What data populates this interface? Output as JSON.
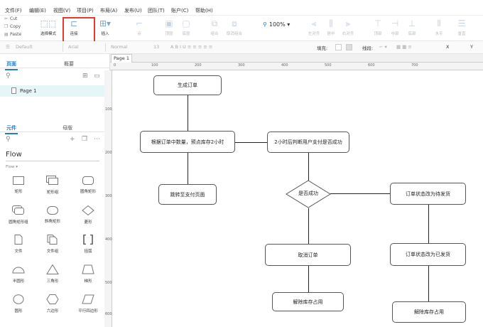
{
  "menubar": {
    "items": [
      "文件(F)",
      "编辑(E)",
      "视图(V)",
      "项目(P)",
      "布局(A)",
      "发布(U)",
      "团队(T)",
      "账户(C)",
      "帮助(H)"
    ]
  },
  "clipboard": {
    "cut": "Cut",
    "copy": "Copy",
    "paste": "Paste"
  },
  "toolbar": {
    "select_mode": "选择模式",
    "connect": "连接",
    "insert": "插入",
    "point": "点",
    "top_layer": "顶层",
    "bottom_layer": "底层",
    "combine": "组合",
    "uncombine": "取消组合",
    "zoom": "100%",
    "align_left": "左对齐",
    "align_center": "居中",
    "align_right": "右对齐",
    "align_top": "顶部",
    "align_middle": "中部",
    "align_bottom": "底部",
    "distribute_h": "水平",
    "distribute_v": "垂直"
  },
  "formatbar": {
    "style": "Default",
    "font": "Arial",
    "weight": "Normal",
    "size": "13",
    "fill_label": "填充:",
    "line_label": "线段:",
    "x_label": "X",
    "y_label": "Y"
  },
  "pages_panel": {
    "tabs": [
      "页面",
      "概要"
    ],
    "pages": [
      "Page 1"
    ]
  },
  "library_panel": {
    "tabs": [
      "元件",
      "母版"
    ],
    "library_name": "Flow",
    "section": "Flow ▾",
    "widgets": [
      "矩形",
      "矩形组",
      "圆角矩形",
      "圆角矩形组",
      "斜角矩形",
      "菱形",
      "文件",
      "文件组",
      "括弧",
      "半圆形",
      "三角形",
      "梯形",
      "圆形",
      "六边形",
      "平行四边形"
    ]
  },
  "document": {
    "tab": "Page 1",
    "hruler": [
      "0",
      "100",
      "200",
      "300",
      "400",
      "500",
      "600",
      "700"
    ],
    "vruler": [
      "100",
      "200",
      "300",
      "400",
      "500",
      "600",
      "700"
    ]
  },
  "flowchart": {
    "generate_order": "生成订单",
    "reserve_stock": "根据订单中数量，预点库存2小时",
    "check_paid": "2小时后判断用户支付是否成功",
    "goto_pay": "跳转至支付页面",
    "is_success": "是否成功",
    "status_pending": "订单状态改为待发货",
    "cancel_order": "取消订单",
    "status_shipped": "订单状态改为已发货",
    "release_stock_left": "解除库存占用",
    "release_stock_right": "解除库存占用"
  }
}
